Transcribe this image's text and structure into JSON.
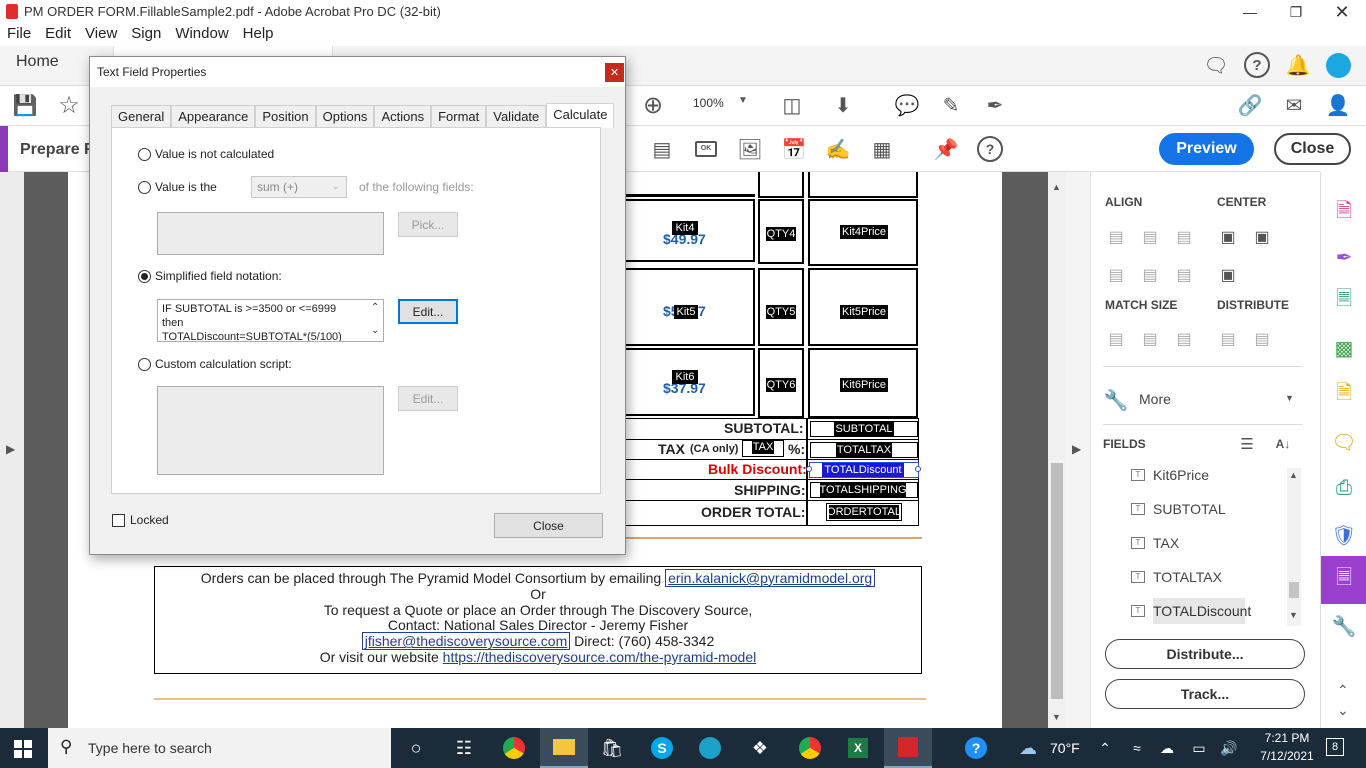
{
  "window": {
    "title": "PM ORDER FORM.FillableSample2.pdf - Adobe Acrobat Pro DC (32-bit)"
  },
  "menu": [
    "File",
    "Edit",
    "View",
    "Sign",
    "Window",
    "Help"
  ],
  "tabs": {
    "home": "Home"
  },
  "toolbar": {
    "zoom": "100%"
  },
  "prepare": {
    "label": "Prepare F",
    "preview": "Preview",
    "close": "Close"
  },
  "form": {
    "kit4": "Kit4",
    "price4": "$49.97",
    "qty4": "QTY4",
    "kit4price": "Kit4Price",
    "kit5": "Kit5",
    "price5": "$57.97",
    "qty5": "QTY5",
    "kit5price": "Kit5Price",
    "kit6": "Kit6",
    "price6": "$37.97",
    "qty6": "QTY6",
    "kit6price": "Kit6Price",
    "subtotal_label": "SUBTOTAL:",
    "subtotal_field": "SUBTOTAL",
    "tax_label": "TAX",
    "tax_note": "(CA only)",
    "tax_field": "TAX",
    "pct": "%:",
    "totaltax_field": "TOTALTAX",
    "bulk_label": "Bulk Discount:",
    "totaldiscount_field": "TOTALDiscount",
    "shipping_label": "SHIPPING:",
    "totalshipping_field": "TOTALSHIPPING",
    "order_label": "ORDER TOTAL:",
    "ordertotal_field": "ORDERTOTAL",
    "info": {
      "line1": "Orders can be placed through The Pyramid Model Consortium by emailing",
      "email1": "erin.kalanick@pyramidmodel.org",
      "or": "Or",
      "line2": "To request a Quote or place an Order through The Discovery Source,",
      "line3": "Contact: National Sales Director - Jeremy Fisher",
      "email2": "jfisher@thediscoverysource.com",
      "direct": "Direct: (760) 458-3342",
      "visit": "Or visit our website",
      "url": "https://thediscoverysource.com/the-pyramid-model"
    }
  },
  "dialog": {
    "title": "Text Field Properties",
    "tabs": [
      "General",
      "Appearance",
      "Position",
      "Options",
      "Actions",
      "Format",
      "Validate",
      "Calculate"
    ],
    "opt_not_calc": "Value is not calculated",
    "opt_value_is": "Value is the",
    "op_select": "sum (+)",
    "of_following": "of the following fields:",
    "pick": "Pick...",
    "opt_simplified": "Simplified field notation:",
    "notation_l1": "IF SUBTOTAL is >=3500 or <=6999",
    "notation_l2": "then",
    "notation_l3": "TOTALDiscount=SUBTOTAL*(5/100)",
    "edit1": "Edit...",
    "opt_custom": "Custom calculation script:",
    "edit2": "Edit...",
    "locked": "Locked",
    "close": "Close"
  },
  "rightpanel": {
    "align": "ALIGN",
    "center": "CENTER",
    "match_size": "MATCH SIZE",
    "distribute": "DISTRIBUTE",
    "more": "More",
    "fields": "FIELDS",
    "field_items": [
      "Kit6Price",
      "SUBTOTAL",
      "TAX",
      "TOTALTAX",
      "TOTALDiscount"
    ],
    "distribute_btn": "Distribute...",
    "track_btn": "Track..."
  },
  "taskbar": {
    "search_placeholder": "Type here to search",
    "weather": "70°F",
    "time": "7:21 PM",
    "date": "7/12/2021",
    "notif_count": "8"
  },
  "colors": {
    "accent": "#1473e6",
    "prepare_purple": "#8a3ab9",
    "discount_red": "#e00000",
    "price_blue": "#1f5fa8",
    "taskbar": "#1c2b3a"
  }
}
